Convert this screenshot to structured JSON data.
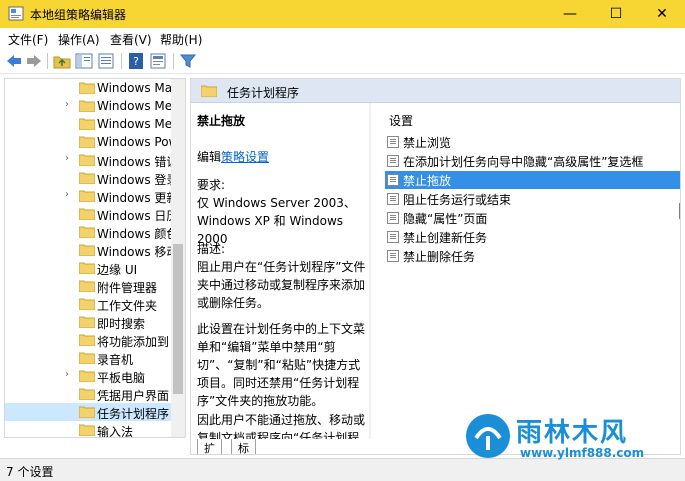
{
  "window": {
    "title": "本地组策略编辑器",
    "minimize_glyph": "—",
    "maximize_glyph": "☐",
    "close_glyph": "✕"
  },
  "menu": [
    "文件(F)",
    "操作(A)",
    "查看(V)",
    "帮助(H)"
  ],
  "toolbar": {
    "icons": [
      "back-arrow-icon",
      "forward-arrow-icon",
      "up-folder-icon",
      "show-hide-tree-icon",
      "help-icon",
      "properties-icon",
      "filter-icon"
    ]
  },
  "tree": {
    "items": [
      {
        "label": "Windows Mai",
        "has_children": false
      },
      {
        "label": "Windows Med",
        "has_children": true
      },
      {
        "label": "Windows Mes",
        "has_children": false
      },
      {
        "label": "Windows Pow",
        "has_children": false
      },
      {
        "label": "Windows 错误",
        "has_children": true
      },
      {
        "label": "Windows 登录",
        "has_children": false
      },
      {
        "label": "Windows 更新",
        "has_children": true
      },
      {
        "label": "Windows 日历",
        "has_children": false
      },
      {
        "label": "Windows 颜色",
        "has_children": false
      },
      {
        "label": "Windows 移动",
        "has_children": false
      },
      {
        "label": "边缘 UI",
        "has_children": false
      },
      {
        "label": "附件管理器",
        "has_children": false
      },
      {
        "label": "工作文件夹",
        "has_children": false
      },
      {
        "label": "即时搜索",
        "has_children": false
      },
      {
        "label": "将功能添加到 W",
        "has_children": false
      },
      {
        "label": "录音机",
        "has_children": false
      },
      {
        "label": "平板电脑",
        "has_children": true
      },
      {
        "label": "凭据用户界面",
        "has_children": false
      },
      {
        "label": "任务计划程序",
        "has_children": false,
        "selected": true
      },
      {
        "label": "输入法",
        "has_children": false
      }
    ]
  },
  "header": {
    "title": "任务计划程序"
  },
  "description": {
    "title": "禁止拖放",
    "edit_prefix": "编辑",
    "edit_link": "策略设置",
    "requirements_label": "要求:",
    "requirements_text": "仅 Windows Server 2003、Windows XP 和 Windows 2000",
    "desc_label": "描述:",
    "desc_text": "阻止用户在“任务计划程序”文件夹中通过移动或复制程序来添加或删除任务。",
    "desc_text2": "此设置在计划任务中的上下文菜单和“编辑”菜单中禁用“剪切”、“复制”和“粘贴”快捷方式项目。同时还禁用“任务计划程序”文件夹的拖放功能。",
    "desc_text3": "因此用户不能通过拖放、移动或复制文档或程序向“任务计划程序”文"
  },
  "settings": {
    "header": "设置",
    "items": [
      {
        "label": "禁止浏览"
      },
      {
        "label": "在添加计划任务向导中隐藏“高级属性”复选框"
      },
      {
        "label": "禁止拖放",
        "selected": true
      },
      {
        "label": "阻止任务运行或结束"
      },
      {
        "label": "隐藏“属性”页面"
      },
      {
        "label": "禁止创建新任务"
      },
      {
        "label": "禁止删除任务"
      }
    ]
  },
  "tabs": [
    "扩展",
    "标准"
  ],
  "status": {
    "text": "7 个设置"
  },
  "watermark": {
    "title": "雨林木风",
    "url": "www.ylmf888.com"
  },
  "colors": {
    "titlebar": "#f7d533",
    "selection": "#3390e6",
    "tree_selection": "#cce8ff",
    "header": "#dde6f2",
    "watermark": "#1a8fd8"
  }
}
